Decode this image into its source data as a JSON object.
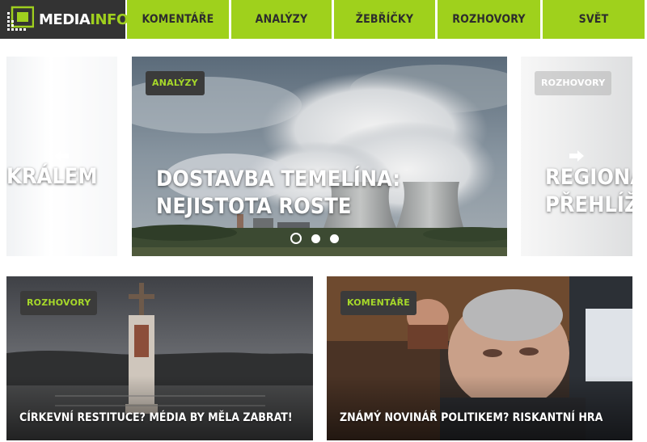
{
  "brand": {
    "logo_main": "MEDIA",
    "logo_accent": "INFO"
  },
  "nav": {
    "items": [
      {
        "label": "KOMENTÁŘE"
      },
      {
        "label": "ANALÝZY"
      },
      {
        "label": "ŽEBŘÍČKY"
      },
      {
        "label": "ROZHOVORY"
      },
      {
        "label": "SVĚT"
      }
    ]
  },
  "carousel": {
    "prev": {
      "headline": "KRÁLEM"
    },
    "current": {
      "tag": "ANALÝZY",
      "headline": "DOSTAVBA TEMELÍNA: NEJISTOTA ROSTE"
    },
    "next": {
      "tag": "ROZHOVORY",
      "headline": "REGIONÁL PŘEHLÍŽE"
    },
    "dots": 3,
    "active_dot": 1
  },
  "cards": [
    {
      "tag": "ROZHOVORY",
      "title": "CÍRKEVNÍ RESTITUCE? MÉDIA BY MĚLA ZABRAT!"
    },
    {
      "tag": "KOMENTÁŘE",
      "title": "ZNÁMÝ NOVINÁŘ POLITIKEM? RISKANTNÍ HRA"
    }
  ],
  "colors": {
    "accent": "#9fd11c",
    "dark": "#333333",
    "tag_text": "#a6d82a"
  },
  "icons": [
    "arrow-left-icon",
    "arrow-right-icon",
    "logo-grid-icon"
  ]
}
